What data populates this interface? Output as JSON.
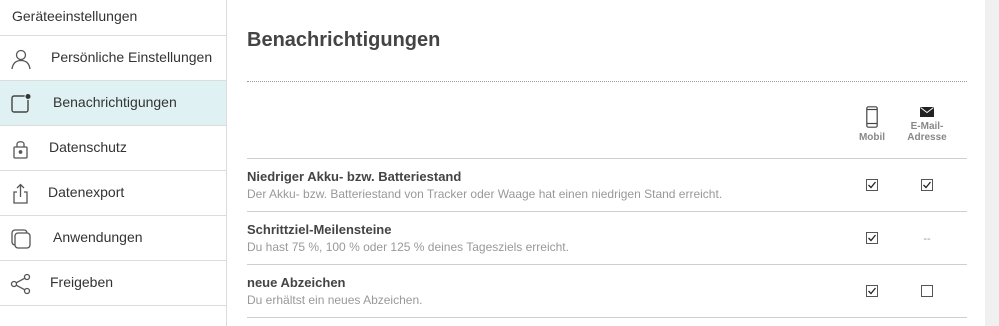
{
  "sidebar": {
    "header": "Geräteeinstellungen",
    "items": [
      {
        "label": "Persönliche Einstellungen",
        "icon": "person-icon"
      },
      {
        "label": "Benachrichtigungen",
        "icon": "notification-icon",
        "active": true
      },
      {
        "label": "Datenschutz",
        "icon": "lock-icon"
      },
      {
        "label": "Datenexport",
        "icon": "export-icon"
      },
      {
        "label": "Anwendungen",
        "icon": "apps-icon"
      },
      {
        "label": "Freigeben",
        "icon": "share-icon"
      }
    ]
  },
  "main": {
    "title": "Benachrichtigungen",
    "columns": {
      "mobile": {
        "label": "Mobil",
        "icon": "phone-icon"
      },
      "email": {
        "line1": "E-Mail-",
        "line2": "Adresse",
        "icon": "envelope-icon"
      }
    },
    "rows": [
      {
        "title": "Niedriger Akku- bzw. Batteriestand",
        "description": "Der Akku- bzw. Batteriestand von Tracker oder Waage hat einen niedrigen Stand erreicht.",
        "mobile": true,
        "email": true
      },
      {
        "title": "Schrittziel-Meilensteine",
        "description": "Du hast 75 %, 100 % oder 125 % deines Tagesziels erreicht.",
        "mobile": true,
        "email_text": "--"
      },
      {
        "title": "neue Abzeichen",
        "description": "Du erhältst ein neues Abzeichen.",
        "mobile": true,
        "email": false
      }
    ]
  },
  "colors": {
    "active_bg": "#dff1f2",
    "page_bg": "#f0f0f0"
  }
}
